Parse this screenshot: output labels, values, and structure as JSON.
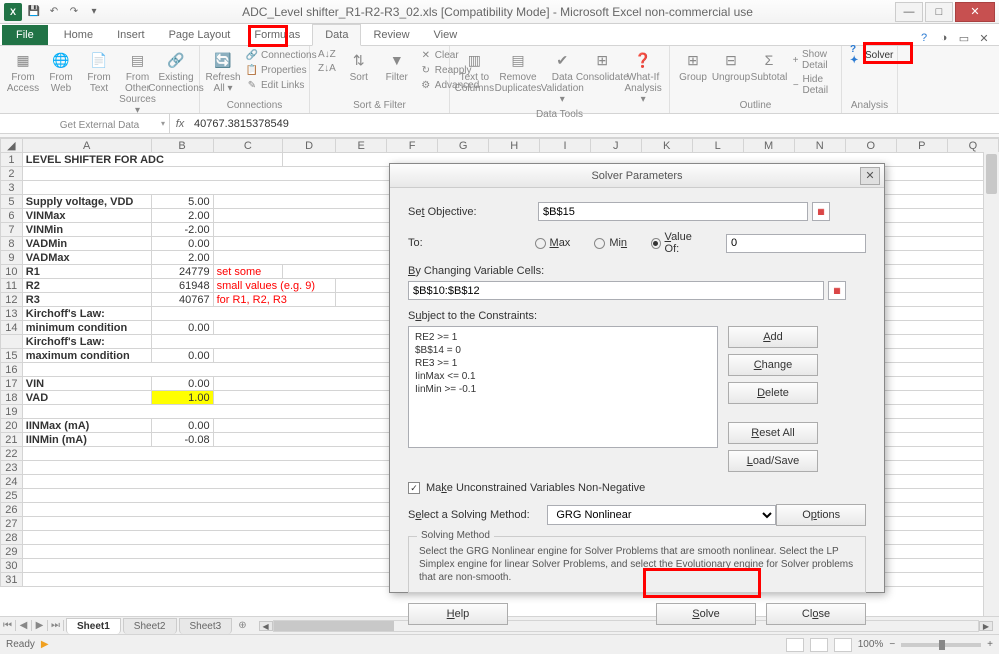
{
  "title": "ADC_Level shifter_R1-R2-R3_02.xls  [Compatibility Mode] - Microsoft Excel non-commercial use",
  "tabs": {
    "file": "File",
    "home": "Home",
    "insert": "Insert",
    "pagelayout": "Page Layout",
    "formulas": "Formulas",
    "data": "Data",
    "review": "Review",
    "view": "View"
  },
  "ribbon": {
    "groups": {
      "getdata": "Get External Data",
      "connections": "Connections",
      "sortfilter": "Sort & Filter",
      "datatools": "Data Tools",
      "outline": "Outline",
      "analysis": "Analysis"
    },
    "btns": {
      "fromAccess": "From\nAccess",
      "fromWeb": "From\nWeb",
      "fromText": "From\nText",
      "fromOther": "From Other\nSources ▾",
      "existing": "Existing\nConnections",
      "refresh": "Refresh\nAll ▾",
      "conn": "Connections",
      "props": "Properties",
      "editlinks": "Edit Links",
      "sortAZ": "A↓Z",
      "sortZA": "Z↓A",
      "sort": "Sort",
      "filter": "Filter",
      "clear": "Clear",
      "reapply": "Reapply",
      "advanced": "Advanced",
      "t2c": "Text to\nColumns",
      "removedup": "Remove\nDuplicates",
      "dataval": "Data\nValidation ▾",
      "consolidate": "Consolidate",
      "whatif": "What-If\nAnalysis ▾",
      "group": "Group",
      "ungroup": "Ungroup",
      "subtotal": "Subtotal",
      "showdetail": "Show Detail",
      "hidedetail": "Hide Detail",
      "solver": "Solver"
    }
  },
  "nameBox": "",
  "formula": "40767.3815378549",
  "cols": [
    "A",
    "B",
    "C",
    "D",
    "E",
    "F",
    "G",
    "H",
    "I",
    "J",
    "K",
    "L",
    "M",
    "N",
    "O",
    "P",
    "Q"
  ],
  "sheet": {
    "r1": {
      "a": "LEVEL SHIFTER FOR ADC"
    },
    "r5": {
      "a": "Supply voltage, VDD",
      "b": "5.00"
    },
    "r6": {
      "a": "VINMax",
      "b": "2.00"
    },
    "r7": {
      "a": "VINMin",
      "b": "-2.00"
    },
    "r8": {
      "a": "VADMin",
      "b": "0.00"
    },
    "r9": {
      "a": "VADMax",
      "b": "2.00"
    },
    "r10": {
      "a": "R1",
      "b": "24779",
      "c": "set some"
    },
    "r11": {
      "a": "R2",
      "b": "61948",
      "c": "small values (e.g. 9)"
    },
    "r12": {
      "a": "R3",
      "b": "40767",
      "c": "for R1, R2, R3"
    },
    "r13": {
      "a": "Kirchoff's Law:"
    },
    "r14": {
      "a": "minimum condition",
      "b": "0.00"
    },
    "r14b": {
      "a": "Kirchoff's Law:"
    },
    "r15": {
      "a": "maximum condition",
      "b": "0.00"
    },
    "r17": {
      "a": "VIN",
      "b": "0.00"
    },
    "r18": {
      "a": "VAD",
      "b": "1.00"
    },
    "r20": {
      "a": "IINMax (mA)",
      "b": "0.00"
    },
    "r21": {
      "a": "IINMin (mA)",
      "b": "-0.08"
    }
  },
  "sheetTabs": {
    "s1": "Sheet1",
    "s2": "Sheet2",
    "s3": "Sheet3"
  },
  "status": {
    "ready": "Ready",
    "zoom": "100%"
  },
  "dialog": {
    "title": "Solver Parameters",
    "setObj": "Set Objective:",
    "objVal": "$B$15",
    "to": "To:",
    "max": "Max",
    "min": "Min",
    "valueOf": "Value Of:",
    "valueOfVal": "0",
    "byChanging": "By Changing Variable Cells:",
    "cellsVal": "$B$10:$B$12",
    "subjectTo": "Subject to the Constraints:",
    "constraints": [
      "RE2 >= 1",
      "$B$14 = 0",
      "RE3 >= 1",
      "IinMax <= 0.1",
      "IinMin >= -0.1"
    ],
    "add": "Add",
    "change": "Change",
    "delete": "Delete",
    "resetAll": "Reset All",
    "loadSave": "Load/Save",
    "makeUnconstrained": "Make Unconstrained Variables Non-Negative",
    "selectMethod": "Select a Solving Method:",
    "method": "GRG Nonlinear",
    "options": "Options",
    "methodTitle": "Solving Method",
    "methodDesc": "Select the GRG Nonlinear engine for Solver Problems that are smooth nonlinear. Select the LP Simplex engine for linear Solver Problems, and select the Evolutionary engine for Solver problems that are non-smooth.",
    "help": "Help",
    "solve": "Solve",
    "close": "Close"
  }
}
